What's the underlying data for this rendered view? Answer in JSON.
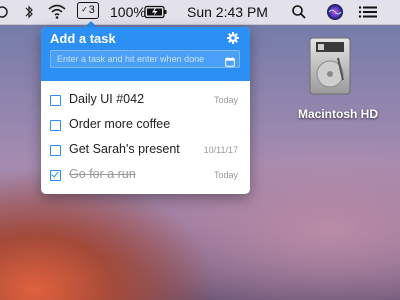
{
  "menubar": {
    "tray_label": "3",
    "battery": "100%",
    "clock": "Sun 2:43 PM"
  },
  "popover": {
    "title": "Add a task",
    "input_placeholder": "Enter a task and hit enter when done",
    "tasks": [
      {
        "label": "Daily UI #042",
        "date": "Today",
        "done": false
      },
      {
        "label": "Order more coffee",
        "date": "",
        "done": false
      },
      {
        "label": "Get Sarah's present",
        "date": "10/11/17",
        "done": false
      },
      {
        "label": "Go for a run",
        "date": "Today",
        "done": true
      }
    ]
  },
  "desktop": {
    "disk_label": "Macintosh HD"
  },
  "colors": {
    "accent": "#2b8ff3"
  }
}
